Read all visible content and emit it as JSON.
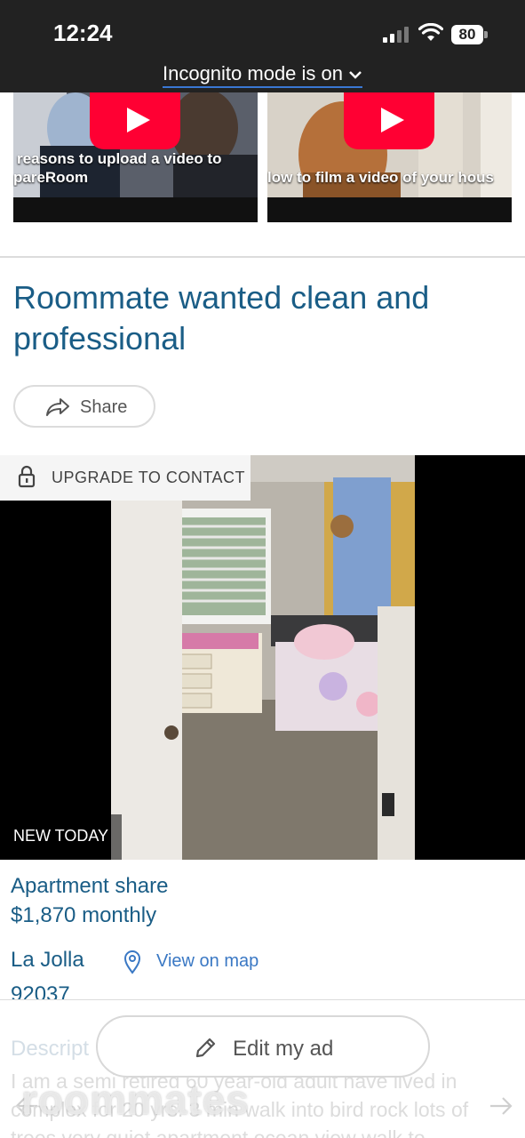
{
  "status_bar": {
    "time": "12:24",
    "battery": "80",
    "incognito_text": "Incognito mode is on"
  },
  "videos": [
    {
      "caption_line1": "reasons to upload a video to",
      "caption_line2": "pareRoom",
      "icon": "youtube-play-icon"
    },
    {
      "caption_line1": "low to film a video of your hous",
      "caption_line2": "",
      "icon": "youtube-play-icon"
    }
  ],
  "listing": {
    "title": "Roommate wanted clean and professional",
    "share_label": "Share",
    "upgrade_label": "UPGRADE TO CONTACT",
    "badge": "NEW TODAY",
    "property_type": "Apartment share",
    "price": "$1,870 monthly",
    "area": "La Jolla",
    "zip": "92037",
    "view_on_map": "View on map",
    "description_heading": "Descript",
    "description_text": "I am a semi retired 60 year-old adult have lived in complex for 20 yrs. 3 min walk into bird rock lots of trees very quiet apartment ocean view walk to"
  },
  "edit_button_label": "Edit my ad",
  "watermark": "roommates",
  "colors": {
    "link_blue": "#1a5d86",
    "accent_blue": "#3a78c4",
    "youtube_red": "#ff0033",
    "status_bar_bg": "#222222"
  }
}
